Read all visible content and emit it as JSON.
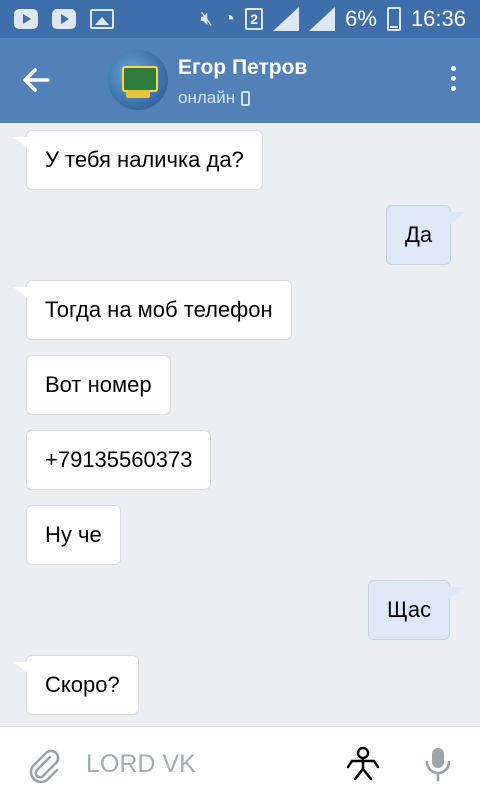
{
  "status_bar": {
    "battery_percent": "6%",
    "time": "16:36",
    "sim_slot": "2",
    "icons": [
      "youtube-icon",
      "youtube-icon",
      "image-icon",
      "mute-icon",
      "wifi-icon",
      "sim-icon",
      "signal-icon",
      "signal-icon",
      "battery-icon"
    ]
  },
  "header": {
    "name": "Егор Петров",
    "status": "онлайн"
  },
  "messages": [
    {
      "direction": "in",
      "text": "У тебя наличка да?"
    },
    {
      "direction": "out",
      "text": "Да"
    },
    {
      "direction": "in",
      "text": "Тогда на моб телефон"
    },
    {
      "direction": "in",
      "text": "Вот номер"
    },
    {
      "direction": "in",
      "text": "+79135560373"
    },
    {
      "direction": "in",
      "text": "Ну че"
    },
    {
      "direction": "out",
      "text": "Щас"
    },
    {
      "direction": "in",
      "text": "Скоро?"
    }
  ],
  "composer": {
    "placeholder": "LORD VK"
  },
  "colors": {
    "header": "#5181b8",
    "status_bar": "#3f6fab",
    "background": "#ebeef2",
    "outgoing_bubble": "#dfe8f6"
  }
}
